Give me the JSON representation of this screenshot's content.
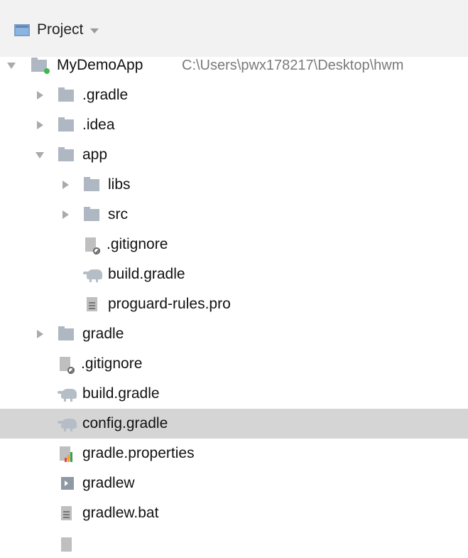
{
  "header": {
    "title": "Project"
  },
  "root": {
    "name": "MyDemoApp",
    "path": "C:\\Users\\pwx178217\\Desktop\\hwm"
  },
  "items": [
    {
      "name": ".gradle"
    },
    {
      "name": ".idea"
    },
    {
      "name": "app"
    },
    {
      "name": "libs"
    },
    {
      "name": "src"
    },
    {
      "name": ".gitignore"
    },
    {
      "name": "build.gradle"
    },
    {
      "name": "proguard-rules.pro"
    },
    {
      "name": "gradle"
    },
    {
      "name": ".gitignore"
    },
    {
      "name": "build.gradle"
    },
    {
      "name": "config.gradle"
    },
    {
      "name": "gradle.properties"
    },
    {
      "name": "gradlew"
    },
    {
      "name": "gradlew.bat"
    }
  ],
  "selected_item": "config.gradle",
  "colors": {
    "header_bg": "#f2f2f2",
    "selection_bg": "#d5d5d5",
    "folder": "#aeb7c2",
    "module_dot": "#3cb94a"
  }
}
